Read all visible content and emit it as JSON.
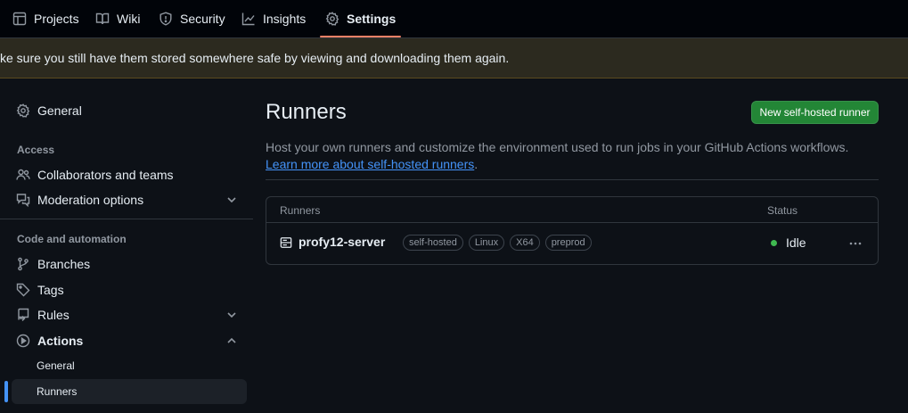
{
  "topnav": {
    "tabs": [
      {
        "label": "Projects",
        "icon": "table-icon"
      },
      {
        "label": "Wiki",
        "icon": "book-icon"
      },
      {
        "label": "Security",
        "icon": "shield-icon"
      },
      {
        "label": "Insights",
        "icon": "graph-icon"
      },
      {
        "label": "Settings",
        "icon": "gear-icon",
        "active": true
      }
    ]
  },
  "banner": {
    "text": "ke sure you still have them stored somewhere safe by viewing and downloading them again."
  },
  "sidebar": {
    "general": "General",
    "access_heading": "Access",
    "collaborators": "Collaborators and teams",
    "moderation": "Moderation options",
    "code_heading": "Code and automation",
    "branches": "Branches",
    "tags": "Tags",
    "rules": "Rules",
    "actions": "Actions",
    "actions_general": "General",
    "actions_runners": "Runners"
  },
  "main": {
    "title": "Runners",
    "new_button": "New self-hosted runner",
    "description": "Host your own runners and customize the environment used to run jobs in your GitHub Actions workflows. ",
    "learn_more": "Learn more about self-hosted runners",
    "description_end": "."
  },
  "runners_table": {
    "col_runners": "Runners",
    "col_status": "Status",
    "rows": [
      {
        "name": "profy12-server",
        "labels": [
          "self-hosted",
          "Linux",
          "X64",
          "preprod"
        ],
        "status": "Idle",
        "status_color": "#3fb950"
      }
    ]
  },
  "colors": {
    "accent_blue": "#4493f8",
    "primary_green": "#238636",
    "active_tab_underline": "#f78166",
    "banner_bg": "#2c2a1f"
  }
}
